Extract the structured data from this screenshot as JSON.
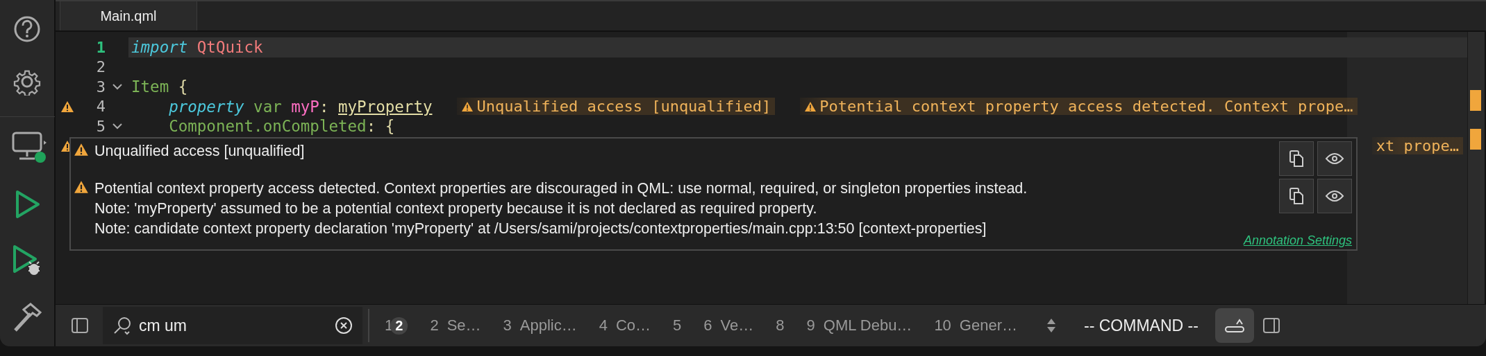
{
  "editor_tabs": [
    {
      "label": "Main.qml",
      "selected": true
    }
  ],
  "code_lines": [
    {
      "number": "1",
      "current": true,
      "foldable": false,
      "warning": false,
      "tokens": [
        {
          "kind": "keyword",
          "text": "import "
        },
        {
          "kind": "module",
          "text": "QtQuick"
        }
      ]
    },
    {
      "number": "2",
      "current": false,
      "foldable": false,
      "warning": false
    },
    {
      "number": "3",
      "current": false,
      "foldable": true,
      "warning": false,
      "tokens": [
        {
          "kind": "type",
          "text": "Item "
        },
        {
          "kind": "punct",
          "text": "{"
        }
      ],
      "children": [
        {
          "number": "4",
          "current": false,
          "foldable": false,
          "warning": true,
          "tokens": [
            {
              "kind": "keyword",
              "text": "property "
            },
            {
              "kind": "type",
              "text": "var "
            },
            {
              "kind": "name",
              "text": "myP"
            },
            {
              "kind": "punct",
              "text": ": "
            },
            {
              "kind": "unqualified",
              "text": "myProperty"
            }
          ],
          "annotations": [
            {
              "text": "Unqualified access [unqualified]",
              "icon": true
            },
            {
              "text": "Potential context property access detected. Context prope…",
              "icon": true
            }
          ]
        },
        {
          "number": "5",
          "current": false,
          "foldable": true,
          "warning": false,
          "tokens": [
            {
              "kind": "type",
              "text": "Component.onCompleted"
            },
            {
              "kind": "punct",
              "text": ": {"
            }
          ]
        }
      ]
    },
    {
      "current": false,
      "foldable": false,
      "warning": true,
      "annotations": [
        {
          "text": "xt prope…",
          "icon": false
        }
      ]
    }
  ],
  "tooltip": {
    "messages": [
      {
        "text": "Unqualified access [unqualified]"
      },
      {
        "text": "Potential context property access detected. Context properties are discouraged in QML: use normal, required, or singleton properties instead.\nNote: 'myProperty' assumed to be a potential context property because it is not declared as required property.\nNote: candidate context property declaration 'myProperty' at /Users/sami/projects/contextproperties/main.cpp:13:50 [context-properties]"
      }
    ],
    "link": "Annotation Settings"
  },
  "sidebar": {
    "device_connected": true
  },
  "bottom_bar": {
    "search": {
      "value": "cm um"
    },
    "panes": [
      {
        "number": "1",
        "badge": "2"
      },
      {
        "number": "2",
        "label": "Se…"
      },
      {
        "number": "3",
        "label": "Applic…"
      },
      {
        "number": "4",
        "label": "Co…"
      },
      {
        "number": "5"
      },
      {
        "number": "6",
        "label": "Ve…"
      },
      {
        "number": "8"
      },
      {
        "number": "9",
        "label": "QML Debu…"
      },
      {
        "number": "10",
        "label": "Gener…"
      }
    ],
    "mode": "-- COMMAND --",
    "toggle_on": true
  }
}
